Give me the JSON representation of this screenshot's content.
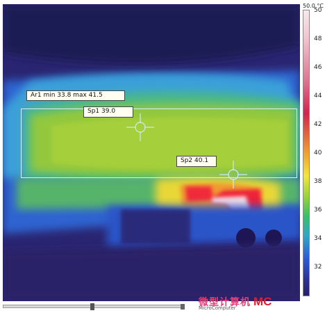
{
  "scale": {
    "top_label": "50.0 °C",
    "ticks": [
      "50",
      "48",
      "46",
      "44",
      "42",
      "40",
      "38",
      "36",
      "34",
      "32"
    ],
    "min": 30.0,
    "max": 50.0
  },
  "measurements": {
    "area_label": "Ar1 min 33.8 max 41.5",
    "sp1_label": "Sp1 39.0",
    "sp2_label": "Sp2 40.1"
  },
  "watermark": {
    "cn": "微型计算机",
    "sub": "MicroComputer",
    "mc": "MC"
  },
  "colors": {
    "hot": "#f41f3c",
    "warm": "#f4d33b",
    "mid": "#9fd13d",
    "cool": "#2b7dd1",
    "cold": "#251c63"
  }
}
